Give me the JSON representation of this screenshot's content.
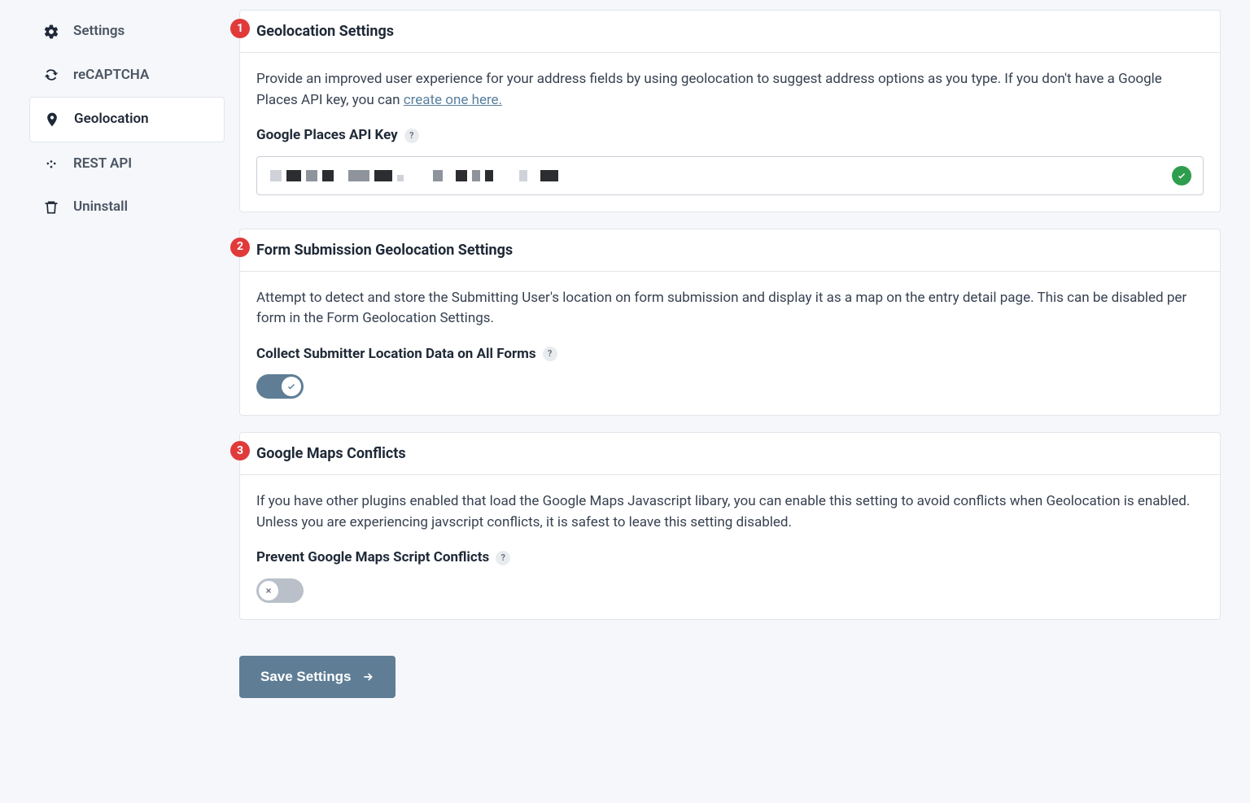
{
  "sidebar": {
    "items": [
      {
        "label": "Settings",
        "icon": "gear-icon",
        "active": false
      },
      {
        "label": "reCAPTCHA",
        "icon": "refresh-icon",
        "active": false
      },
      {
        "label": "Geolocation",
        "icon": "location-pin-icon",
        "active": true
      },
      {
        "label": "REST API",
        "icon": "code-icon",
        "active": false
      },
      {
        "label": "Uninstall",
        "icon": "trash-icon",
        "active": false
      }
    ]
  },
  "sections": {
    "geo": {
      "badge": "1",
      "title": "Geolocation Settings",
      "description_pre": "Provide an improved user experience for your address fields by using geolocation to suggest address options as you type. If you don't have a Google Places API key, you can ",
      "description_link": "create one here.",
      "api_key_label": "Google Places API Key",
      "api_key_valid": true
    },
    "form_submission": {
      "badge": "2",
      "title": "Form Submission Geolocation Settings",
      "description": "Attempt to detect and store the Submitting User's location on form submission and display it as a map on the entry detail page. This can be disabled per form in the Form Geolocation Settings.",
      "toggle_label": "Collect Submitter Location Data on All Forms",
      "toggle_on": true
    },
    "conflicts": {
      "badge": "3",
      "title": "Google Maps Conflicts",
      "description": "If you have other plugins enabled that load the Google Maps Javascript libary, you can enable this setting to avoid conflicts when Geolocation is enabled. Unless you are experiencing javscript conflicts, it is safest to leave this setting disabled.",
      "toggle_label": "Prevent Google Maps Script Conflicts",
      "toggle_on": false
    }
  },
  "actions": {
    "save_label": "Save Settings"
  }
}
